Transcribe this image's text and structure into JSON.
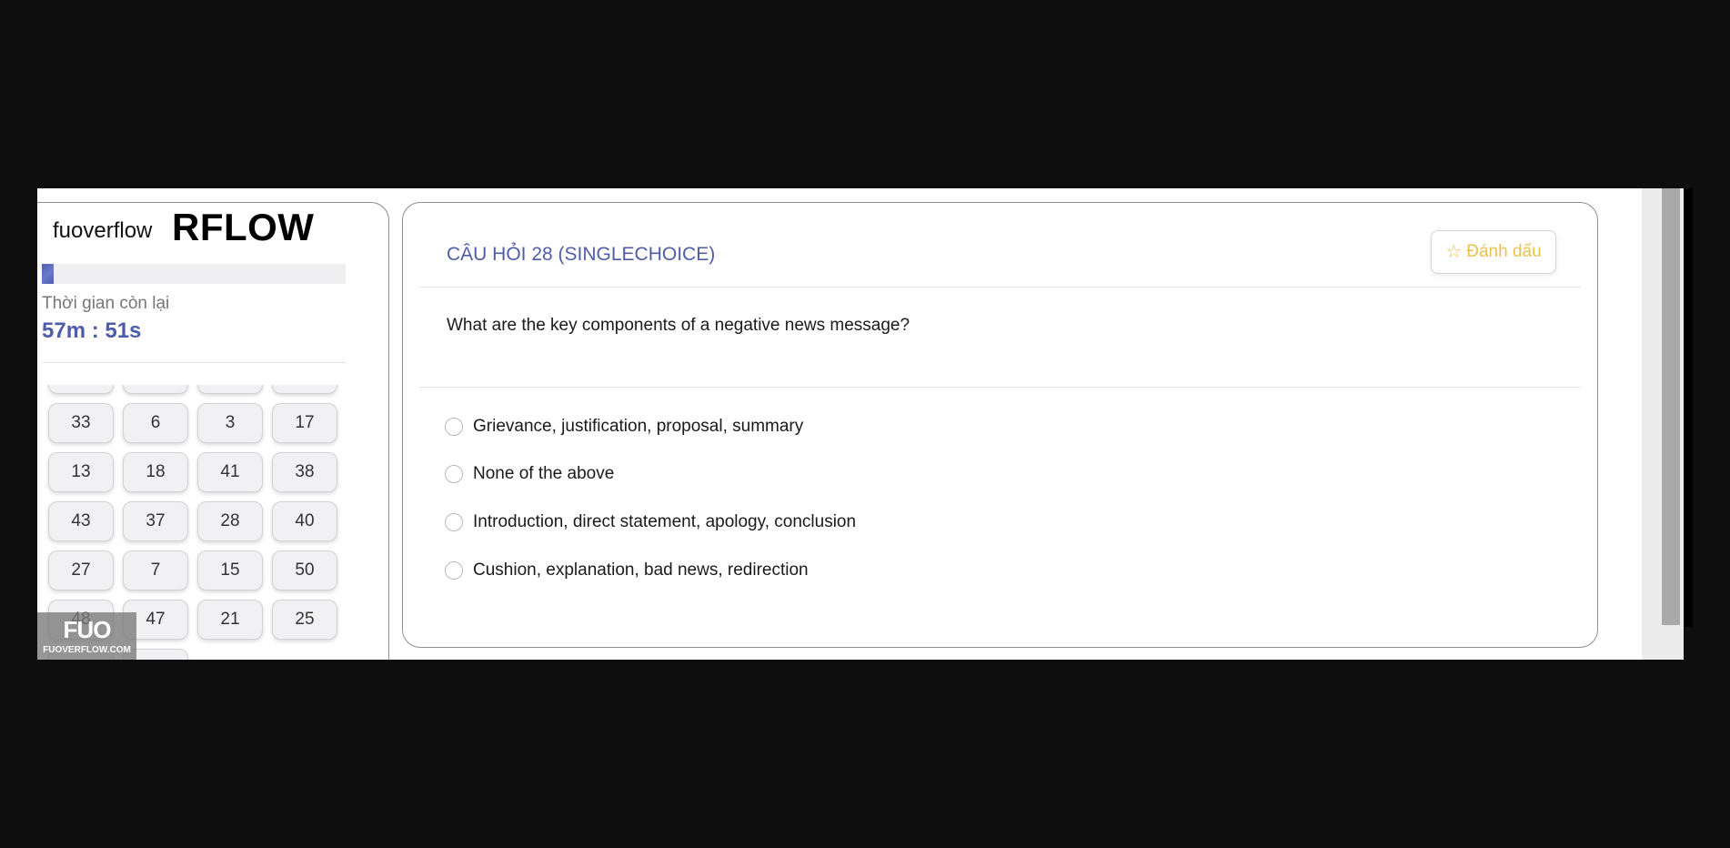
{
  "brand": {
    "small": "fuoverflow",
    "big": "RFLOW"
  },
  "progress": {
    "fraction": 0.04
  },
  "timer": {
    "label": "Thời gian còn lại",
    "value": "57m : 51s"
  },
  "question_grid": {
    "rows": [
      [
        "",
        "",
        "",
        ""
      ],
      [
        "33",
        "6",
        "3",
        "17"
      ],
      [
        "13",
        "18",
        "41",
        "38"
      ],
      [
        "43",
        "37",
        "28",
        "40"
      ],
      [
        "27",
        "7",
        "15",
        "50"
      ],
      [
        "48",
        "47",
        "21",
        "25"
      ],
      [
        "",
        ""
      ]
    ]
  },
  "watermark": {
    "logo": "FUO",
    "text": "FUOVERFLOW.COM"
  },
  "question": {
    "title": "CÂU HỎI 28 (SINGLECHOICE)",
    "mark_label": "Đánh dấu",
    "text": "What are the key components of a negative news message?",
    "options": [
      "Grievance, justification, proposal, summary",
      "None of the above",
      "Introduction, direct statement, apology, conclusion",
      "Cushion, explanation, bad news, redirection"
    ]
  },
  "colors": {
    "accent": "#4f5da8",
    "mark": "#e8c24a",
    "background": "#0e0e0e"
  },
  "icons": {
    "mark": "star-outline-icon"
  }
}
